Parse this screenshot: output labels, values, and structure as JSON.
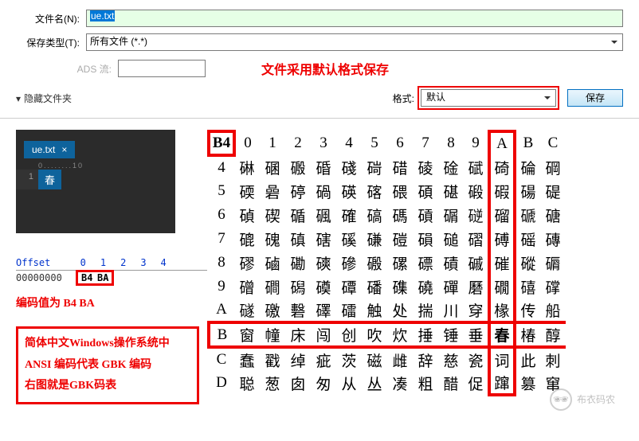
{
  "dialog": {
    "filename_label": "文件名(N):",
    "filename_value": "ue.txt",
    "filetype_label": "保存类型(T):",
    "filetype_value": "所有文件 (*.*)",
    "ads_label": "ADS 流:",
    "annotation_default_save": "文件采用默认格式保存",
    "hide_folders": "隐藏文件夹"
  },
  "format": {
    "label": "格式:",
    "value": "默认"
  },
  "buttons": {
    "save": "保存"
  },
  "editor": {
    "tab_name": "ue.txt",
    "ruler": "0........10",
    "line_num": "1",
    "content": "春"
  },
  "hex": {
    "offset_label": "Offset",
    "cols": [
      "0",
      "1",
      "2",
      "3",
      "4"
    ],
    "offset_val": "00000000",
    "bytes": [
      "B4",
      "BA"
    ],
    "annotation": "编码值为 B4 BA"
  },
  "info_box": {
    "l1": "简体中文Windows操作系统中",
    "l2": "ANSI 编码代表 GBK 编码",
    "l3": "右图就是GBK码表"
  },
  "gbk": {
    "corner": "B4",
    "col_headers": [
      "0",
      "1",
      "2",
      "3",
      "4",
      "5",
      "6",
      "7",
      "8",
      "9",
      "A",
      "B",
      "C"
    ],
    "row_headers": [
      "4",
      "5",
      "6",
      "7",
      "8",
      "9",
      "A",
      "B",
      "C",
      "D"
    ],
    "rows": [
      [
        "碄",
        "碅",
        "磤",
        "碈",
        "碊",
        "碋",
        "碏",
        "碐",
        "碒",
        "碔",
        "碕",
        "碖",
        "碙"
      ],
      [
        "碝",
        "碞",
        "碠",
        "碢",
        "碤",
        "碦",
        "碨",
        "碩",
        "碪",
        "碫",
        "碬",
        "碭",
        "碮"
      ],
      [
        "碵",
        "碶",
        "碷",
        "碸",
        "確",
        "碻",
        "碼",
        "碽",
        "碿",
        "磀",
        "磂",
        "磃",
        "磄"
      ],
      [
        "磇",
        "磈",
        "磌",
        "磍",
        "磎",
        "磏",
        "磑",
        "磒",
        "磓",
        "磖",
        "磗",
        "磘",
        "磚"
      ],
      [
        "磟",
        "磠",
        "磡",
        "磢",
        "磣",
        "磤",
        "磥",
        "磦",
        "磧",
        "磩",
        "磪",
        "磫",
        "磭"
      ],
      [
        "磳",
        "磵",
        "磶",
        "磸",
        "磹",
        "磻",
        "磼",
        "磽",
        "磾",
        "磿",
        "礀",
        "礂",
        "礃"
      ],
      [
        "礈",
        "礉",
        "礊",
        "礋",
        "礌",
        "触",
        "处",
        "揣",
        "川",
        "穿",
        "椽",
        "传",
        "船"
      ],
      [
        "窗",
        "幢",
        "床",
        "闯",
        "创",
        "吹",
        "炊",
        "捶",
        "锤",
        "垂",
        "春",
        "椿",
        "醇"
      ],
      [
        "蠢",
        "戳",
        "绰",
        "疵",
        "茨",
        "磁",
        "雌",
        "辞",
        "慈",
        "瓷",
        "词",
        "此",
        "刺"
      ],
      [
        "聪",
        "葱",
        "囱",
        "匆",
        "从",
        "丛",
        "凑",
        "粗",
        "醋",
        "促",
        "蹿",
        "篡",
        "窜"
      ]
    ]
  },
  "watermark": {
    "icon": "🕶",
    "text": "布衣码农"
  }
}
